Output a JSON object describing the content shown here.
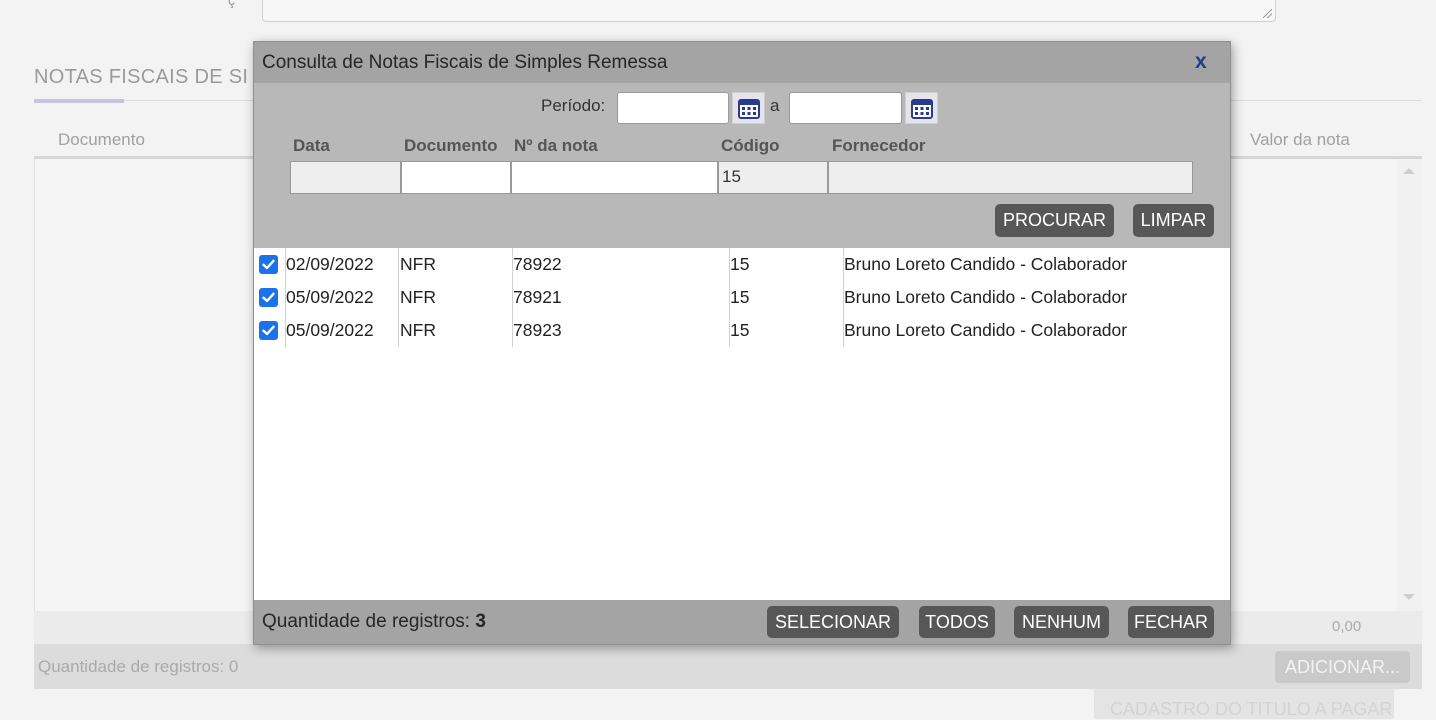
{
  "background": {
    "section_title": "NOTAS FISCAIS DE SI",
    "columns": {
      "documento": "Documento",
      "valor_nota": "Valor da nota"
    },
    "total_value": "0,00",
    "footer_count_label": "Quantidade de registros: 0",
    "add_button": "ADICIONAR...",
    "cut_text": "CADASTRO DO TITULO A PAGAR"
  },
  "modal": {
    "title": "Consulta de Notas Fiscais de Simples Remessa",
    "close_label": "x",
    "filter": {
      "periodo_label": "Período:",
      "periodo_from": "",
      "periodo_separator": "a",
      "periodo_to": "",
      "labels": {
        "data": "Data",
        "documento": "Documento",
        "numero_nota": "Nº da nota",
        "codigo": "Código",
        "fornecedor": "Fornecedor"
      },
      "values": {
        "data": "",
        "documento": "",
        "numero_nota": "",
        "codigo": "15",
        "fornecedor": ""
      },
      "search_button": "PROCURAR",
      "clear_button": "LIMPAR"
    },
    "results": [
      {
        "checked": true,
        "data": "02/09/2022",
        "documento": "NFR",
        "numero_nota": "78922",
        "codigo": "15",
        "fornecedor": "Bruno Loreto Candido - Colaborador"
      },
      {
        "checked": true,
        "data": "05/09/2022",
        "documento": "NFR",
        "numero_nota": "78921",
        "codigo": "15",
        "fornecedor": "Bruno Loreto Candido - Colaborador"
      },
      {
        "checked": true,
        "data": "05/09/2022",
        "documento": "NFR",
        "numero_nota": "78923",
        "codigo": "15",
        "fornecedor": "Bruno Loreto Candido - Colaborador"
      }
    ],
    "footer": {
      "count_label": "Quantidade de registros:",
      "count_value": "3",
      "select_button": "SELECIONAR",
      "all_button": "TODOS",
      "none_button": "NENHUM",
      "close_button": "FECHAR"
    }
  },
  "colors": {
    "title_bar": "#a4a4a4",
    "filter_area": "#b8b8b8",
    "button": "#575757",
    "checkbox": "#1a73e8",
    "close_x": "#2a3a8c"
  }
}
